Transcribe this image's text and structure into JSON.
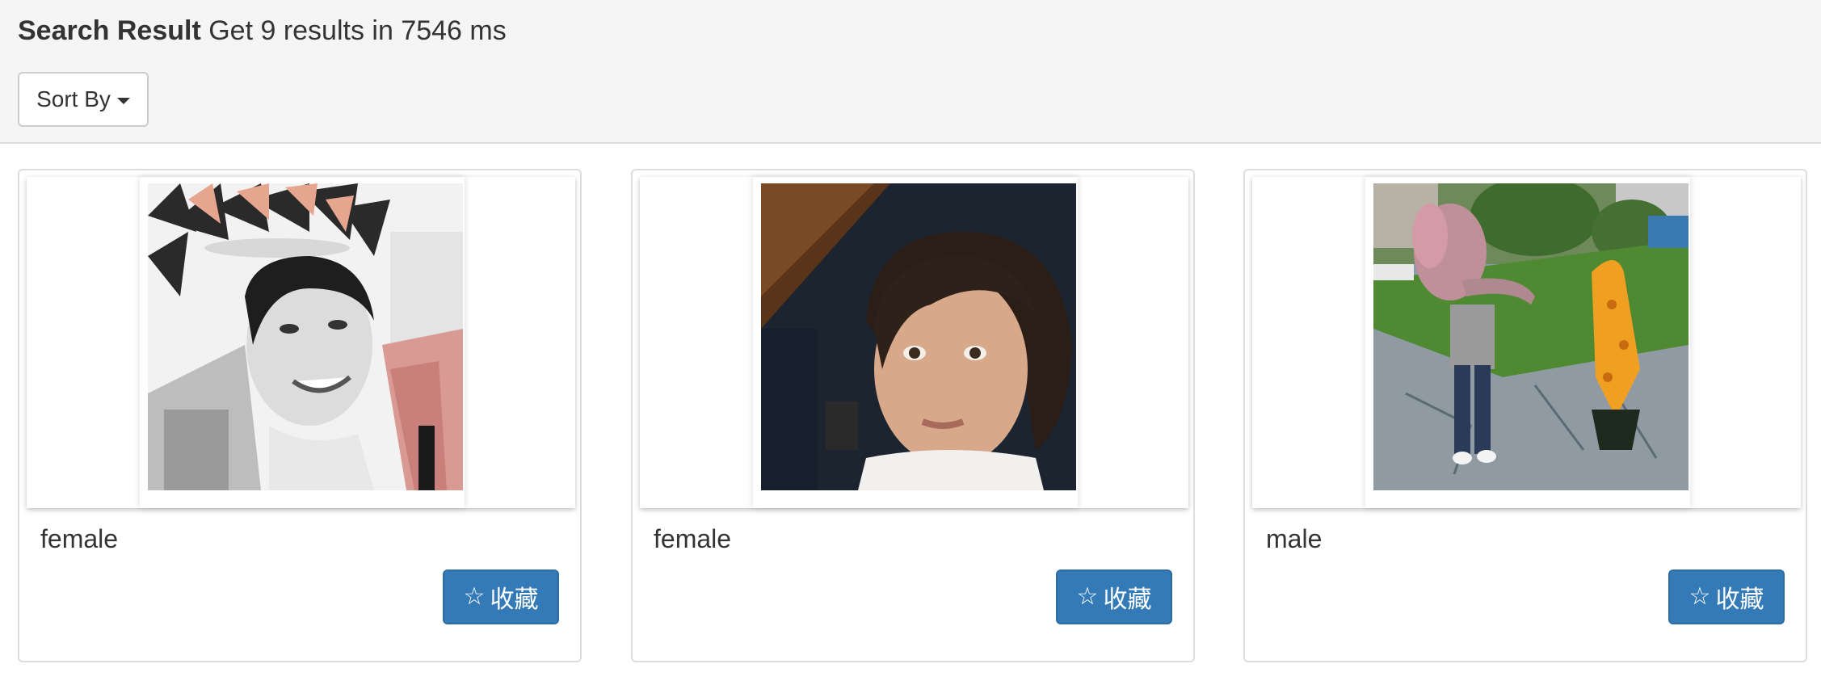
{
  "header": {
    "title_bold": "Search Result",
    "title_rest": "Get 9 results in 7546 ms",
    "sort_label": "Sort By"
  },
  "results": [
    {
      "label": "female",
      "fav_label": "收藏",
      "icon": "star-outline-icon"
    },
    {
      "label": "female",
      "fav_label": "收藏",
      "icon": "star-outline-icon"
    },
    {
      "label": "male",
      "fav_label": "收藏",
      "icon": "star-outline-icon"
    }
  ],
  "colors": {
    "header_bg": "#f5f5f5",
    "primary_button": "#337ab7",
    "border": "#dddddd"
  }
}
